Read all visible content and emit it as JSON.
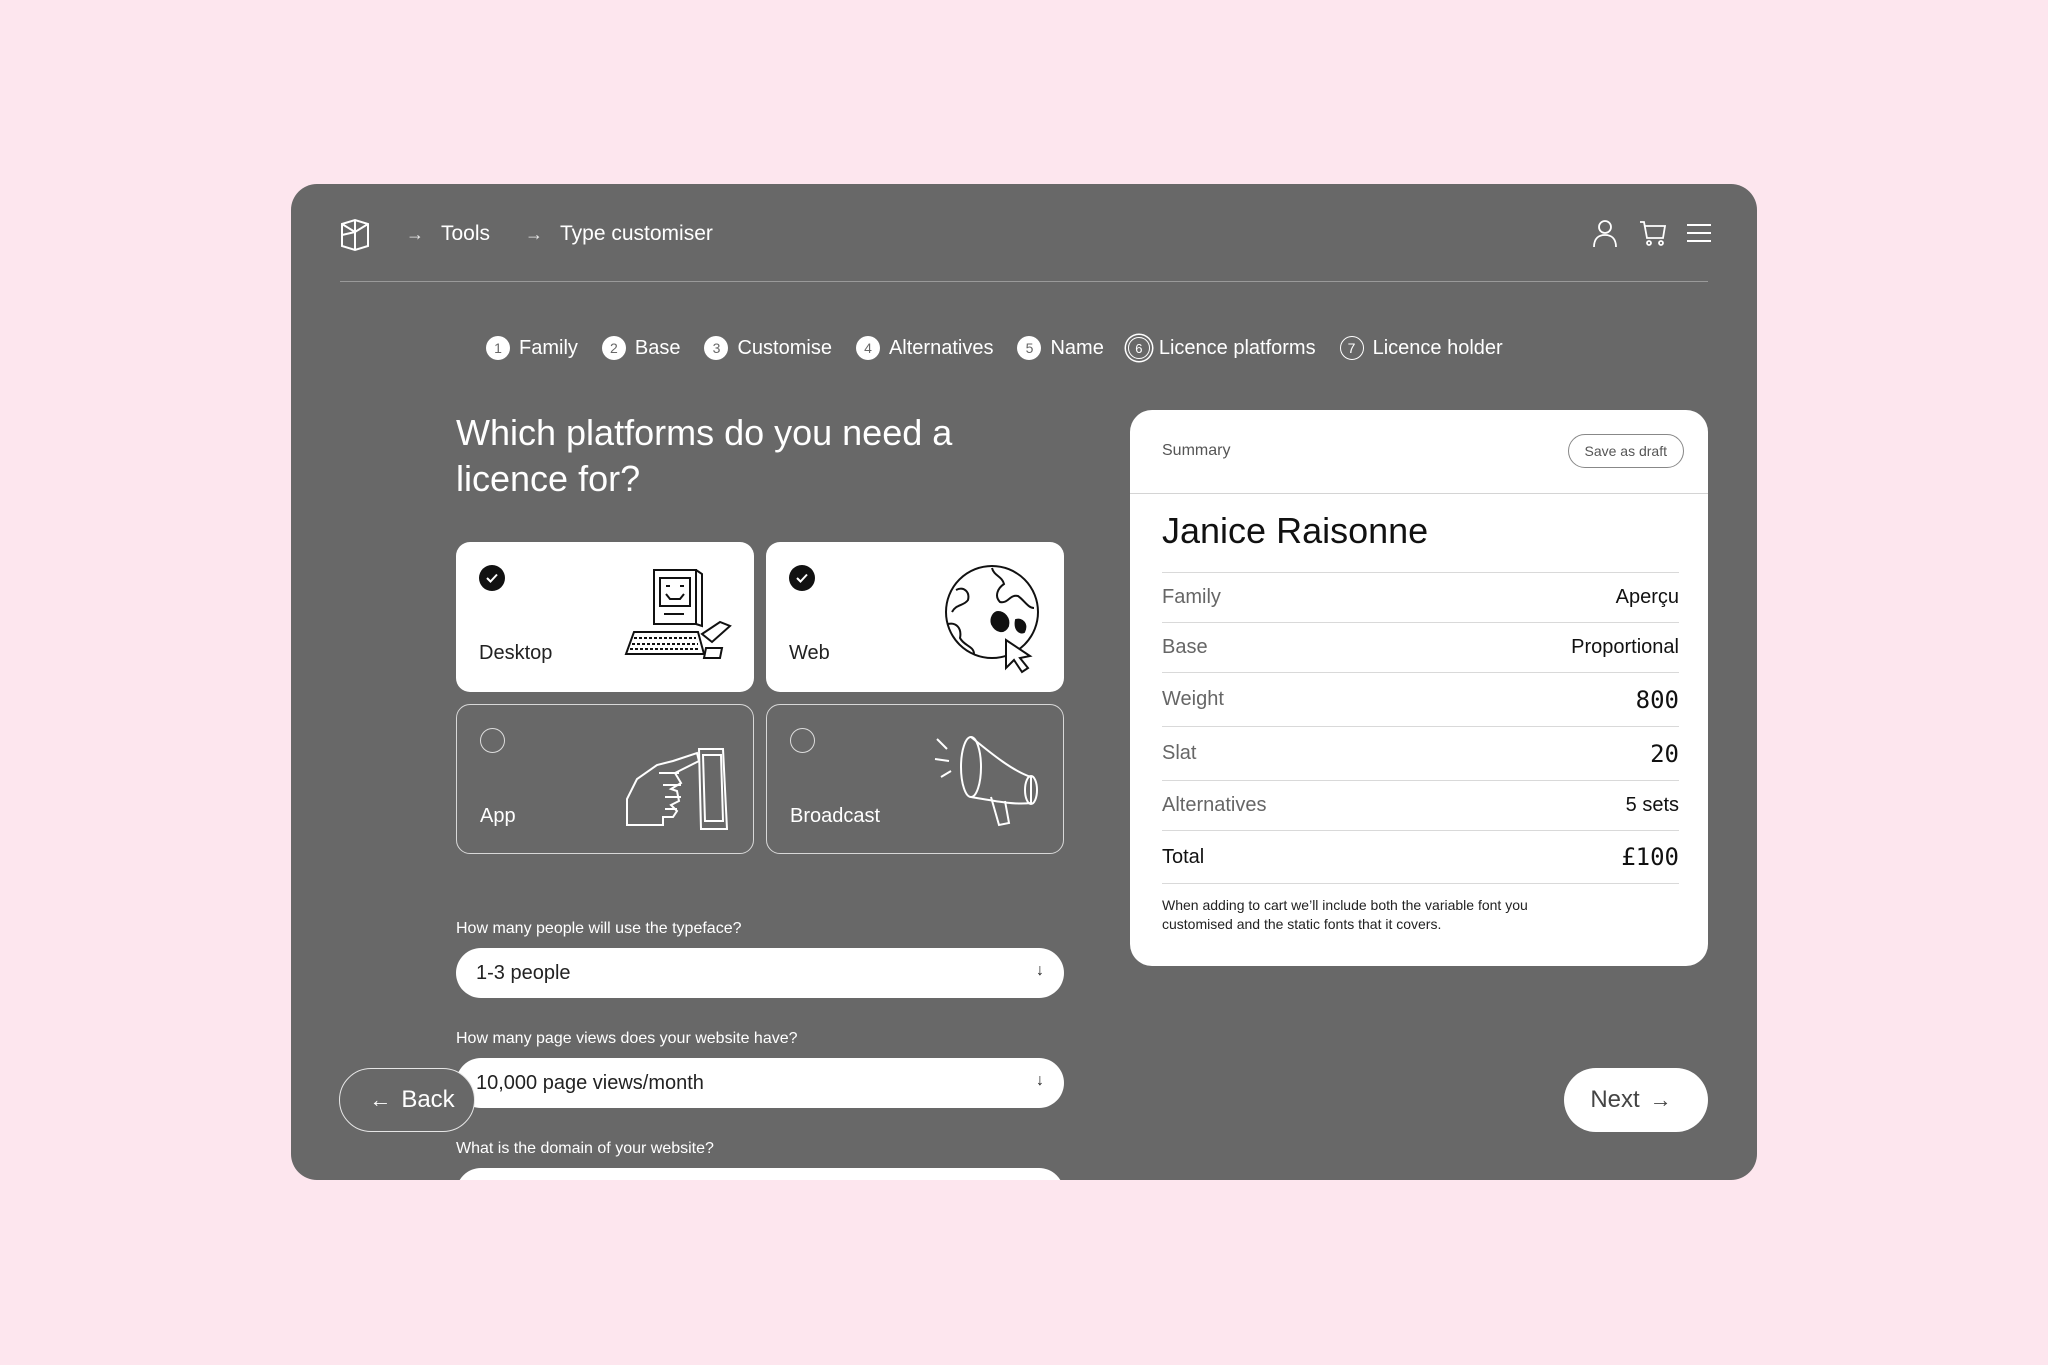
{
  "header": {
    "breadcrumbs": [
      "Tools",
      "Type customiser"
    ],
    "arrow": "→"
  },
  "stepper": [
    {
      "num": "1",
      "label": "Family"
    },
    {
      "num": "2",
      "label": "Base"
    },
    {
      "num": "3",
      "label": "Customise"
    },
    {
      "num": "4",
      "label": "Alternatives"
    },
    {
      "num": "5",
      "label": "Name"
    },
    {
      "num": "6",
      "label": "Licence platforms"
    },
    {
      "num": "7",
      "label": "Licence holder"
    }
  ],
  "question": "Which platforms do you need a licence for?",
  "platforms": [
    {
      "label": "Desktop",
      "selected": true,
      "icon": "computer-icon"
    },
    {
      "label": "Web",
      "selected": true,
      "icon": "globe-icon"
    },
    {
      "label": "App",
      "selected": false,
      "icon": "hand-phone-icon"
    },
    {
      "label": "Broadcast",
      "selected": false,
      "icon": "megaphone-icon"
    }
  ],
  "form": {
    "people_label": "How many people will use the typeface?",
    "people_value": "1-3 people",
    "views_label": "How many page views does your website have?",
    "views_value": "10,000 page views/month",
    "domain_label": "What is the domain of your website?",
    "select_arrow": "↓"
  },
  "summary": {
    "title": "Summary",
    "draft_button": "Save as draft",
    "name": "Janice Raisonne",
    "rows": [
      {
        "key": "Family",
        "value": "Aperçu"
      },
      {
        "key": "Base",
        "value": "Proportional"
      },
      {
        "key": "Weight",
        "value": "800"
      },
      {
        "key": "Slat",
        "value": "20"
      },
      {
        "key": "Alternatives",
        "value": "5 sets"
      },
      {
        "key": "Total",
        "value": "£100"
      }
    ],
    "note": "When adding to cart we’ll include both the variable font you customised and the static fonts that it covers."
  },
  "nav": {
    "back": "Back",
    "next": "Next",
    "back_arrow": "←",
    "next_arrow": "→"
  },
  "colors": {
    "page_bg": "#fde6ee",
    "panel_bg": "#686868",
    "card_bg": "#ffffff"
  }
}
